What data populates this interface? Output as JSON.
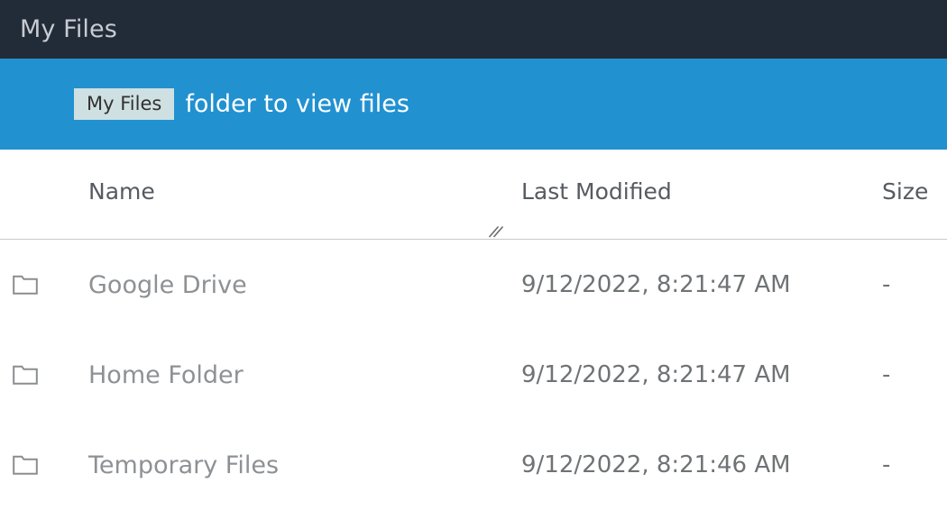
{
  "titlebar": {
    "title": "My Files"
  },
  "banner": {
    "chip_label": "My Files",
    "message": "folder to view files",
    "background_color": "#2191d0",
    "chip_background_color": "#cfe0e2"
  },
  "file_table": {
    "columns": [
      {
        "key": "name",
        "label": "Name"
      },
      {
        "key": "modified",
        "label": "Last Modified"
      },
      {
        "key": "size",
        "label": "Size"
      }
    ],
    "resize_handle_icon": "resize-grip-icon",
    "rows": [
      {
        "icon": "folder-icon",
        "name": "Google Drive",
        "modified": "9/12/2022, 8:21:47 AM",
        "size": "-"
      },
      {
        "icon": "folder-icon",
        "name": "Home Folder",
        "modified": "9/12/2022, 8:21:47 AM",
        "size": "-"
      },
      {
        "icon": "folder-icon",
        "name": "Temporary Files",
        "modified": "9/12/2022, 8:21:46 AM",
        "size": "-"
      }
    ]
  }
}
